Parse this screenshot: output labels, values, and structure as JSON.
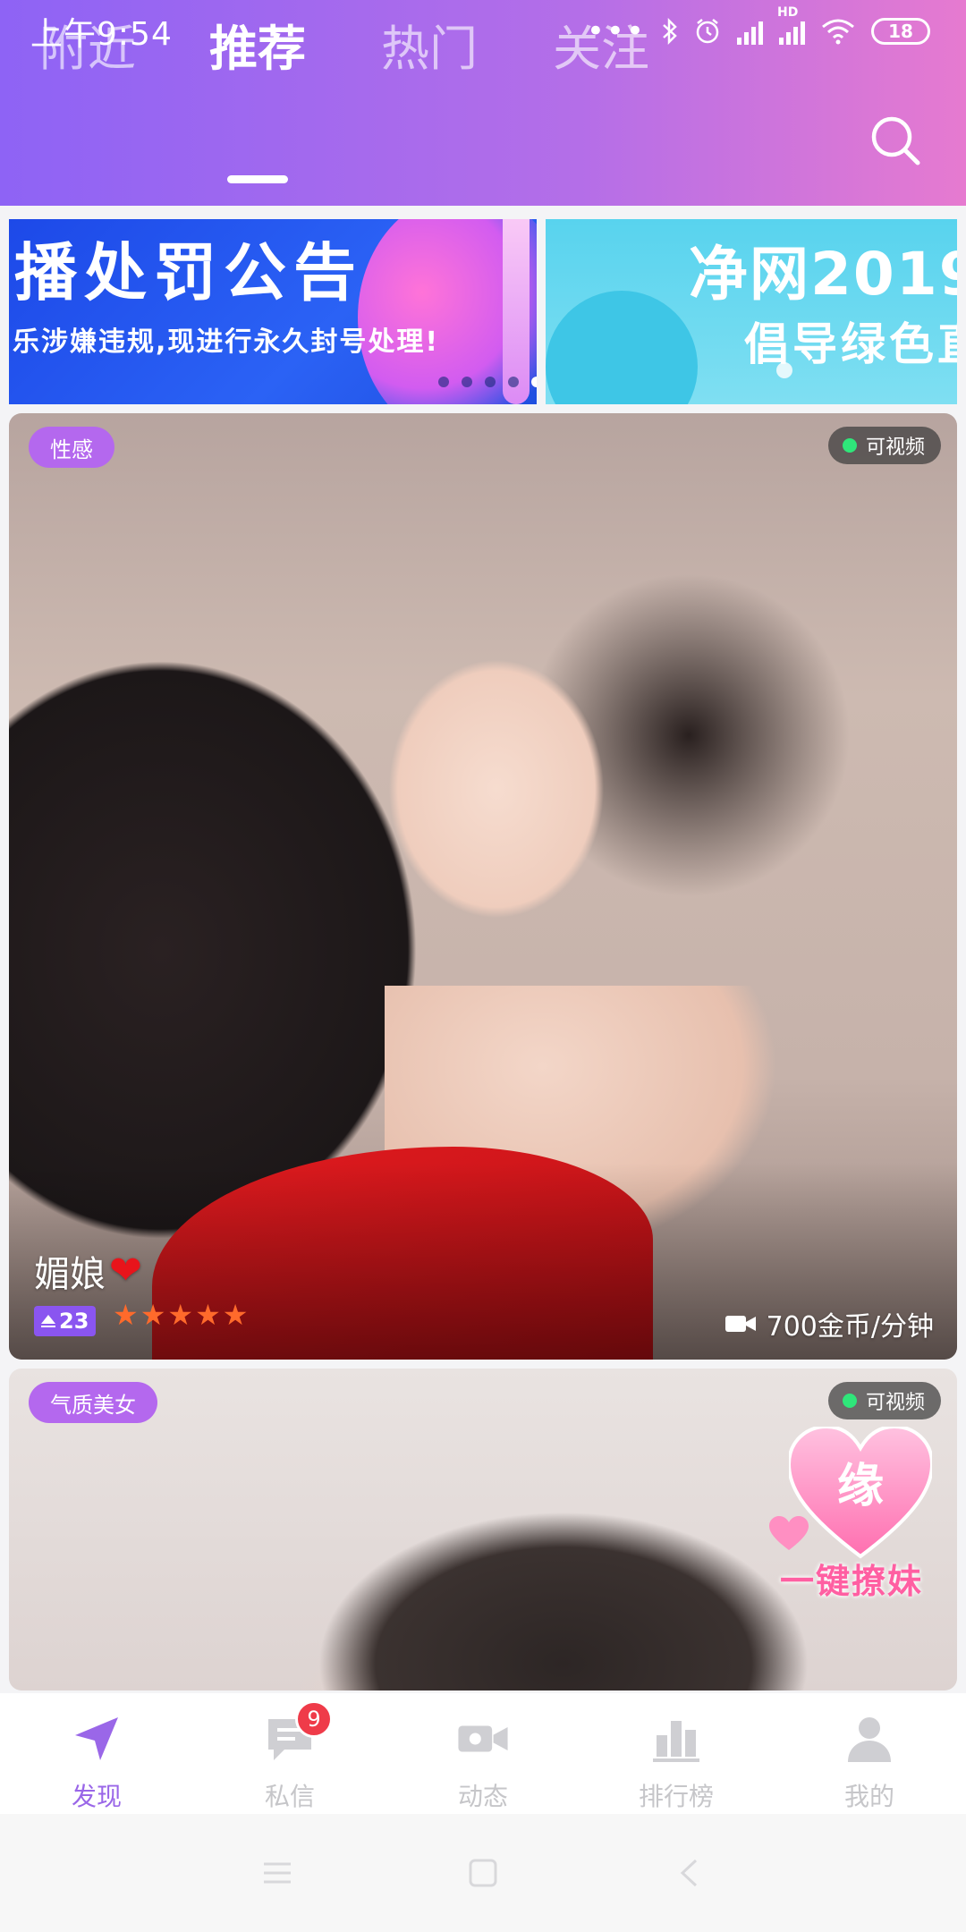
{
  "status_bar": {
    "time": "上午9:54",
    "dots": "•••",
    "hd": "HD",
    "battery": "18"
  },
  "tabs": [
    {
      "label": "附近",
      "active": false
    },
    {
      "label": "推荐",
      "active": true
    },
    {
      "label": "热门",
      "active": false
    },
    {
      "label": "关注",
      "active": false
    }
  ],
  "banner": {
    "left_title": "播处罚公告",
    "left_subtitle": "乐涉嫌违规,现进行永久封号处理!",
    "right_title": "净网2019",
    "right_subtitle": "倡导绿色直"
  },
  "cards": [
    {
      "tag": "性感",
      "video_status": "可视频",
      "name": "媚娘",
      "heart": "❤",
      "level": "23",
      "stars": 5,
      "price": "700金币/分钟"
    },
    {
      "tag": "气质美女",
      "video_status": "可视频"
    }
  ],
  "float_button": {
    "char": "缘",
    "label": "一键撩妹"
  },
  "bottom_nav": [
    {
      "label": "发现",
      "icon": "navigation-arrow-icon",
      "active": true
    },
    {
      "label": "私信",
      "icon": "message-icon",
      "badge": "9"
    },
    {
      "label": "动态",
      "icon": "video-camera-icon"
    },
    {
      "label": "排行榜",
      "icon": "bar-chart-icon"
    },
    {
      "label": "我的",
      "icon": "user-icon"
    }
  ],
  "colors": {
    "header_gradient_start": "#8e63f5",
    "header_gradient_end": "#e67ad0",
    "tag_purple": "#b468ee",
    "active_nav": "#9a67e8",
    "badge_red": "#ef3b49",
    "star_orange": "#ff6a2b"
  }
}
